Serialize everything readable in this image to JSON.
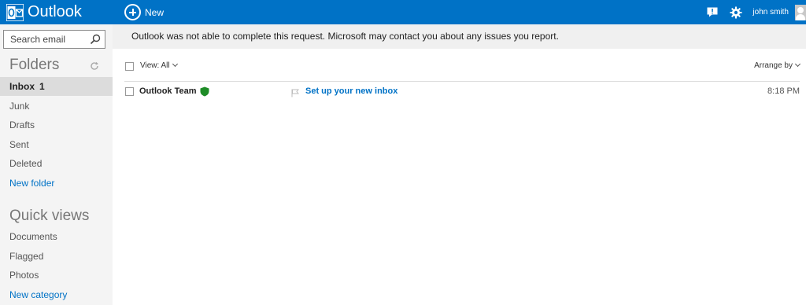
{
  "header": {
    "app_name": "Outlook",
    "new_label": "New",
    "user_name": "john smith",
    "brand_color": "#0072c6",
    "icons": [
      "outlook-logo-icon",
      "new-circle-plus-icon",
      "feedback-icon",
      "gear-icon",
      "avatar"
    ]
  },
  "sidebar": {
    "search_placeholder": "Search email",
    "folders_title": "Folders",
    "folders": [
      {
        "label": "Inbox",
        "count": "1",
        "selected": true
      },
      {
        "label": "Junk"
      },
      {
        "label": "Drafts"
      },
      {
        "label": "Sent"
      },
      {
        "label": "Deleted"
      }
    ],
    "new_folder_label": "New folder",
    "quick_views_title": "Quick views",
    "quick_views": [
      {
        "label": "Documents"
      },
      {
        "label": "Flagged"
      },
      {
        "label": "Photos"
      }
    ],
    "new_category_label": "New category"
  },
  "main": {
    "banner_text": "Outlook was not able to complete this request. Microsoft may contact you about any issues you report.",
    "view_label": "View: All",
    "arrange_label": "Arrange by",
    "messages": [
      {
        "sender": "Outlook Team",
        "subject": "Set up your new inbox",
        "time": "8:18 PM"
      }
    ]
  }
}
